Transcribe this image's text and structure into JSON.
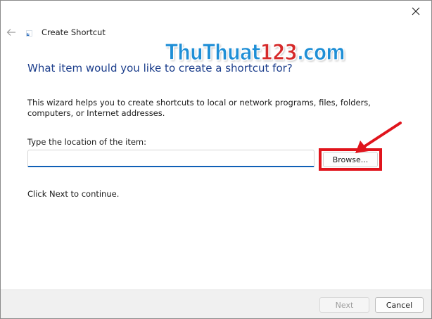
{
  "window": {
    "title": "Create Shortcut"
  },
  "watermark": {
    "part1": "ThuThuat",
    "part2": "123",
    "part3": ".com"
  },
  "content": {
    "heading": "What item would you like to create a shortcut for?",
    "description": "This wizard helps you to create shortcuts to local or network programs, files, folders, computers, or Internet addresses.",
    "location_label": "Type the location of the item:",
    "location_value": "",
    "browse_label": "Browse...",
    "continue_text": "Click Next to continue."
  },
  "footer": {
    "next_label": "Next",
    "cancel_label": "Cancel"
  },
  "colors": {
    "heading": "#1c3e8c",
    "highlight": "#e0141c",
    "input_accent": "#0f5fb6",
    "watermark_blue": "#1f8fd6",
    "watermark_red": "#d62a2a"
  },
  "icons": {
    "close": "close-icon",
    "back": "back-arrow-icon",
    "wizard": "shortcut-wizard-icon",
    "annotation": "red-pointer-arrow"
  }
}
